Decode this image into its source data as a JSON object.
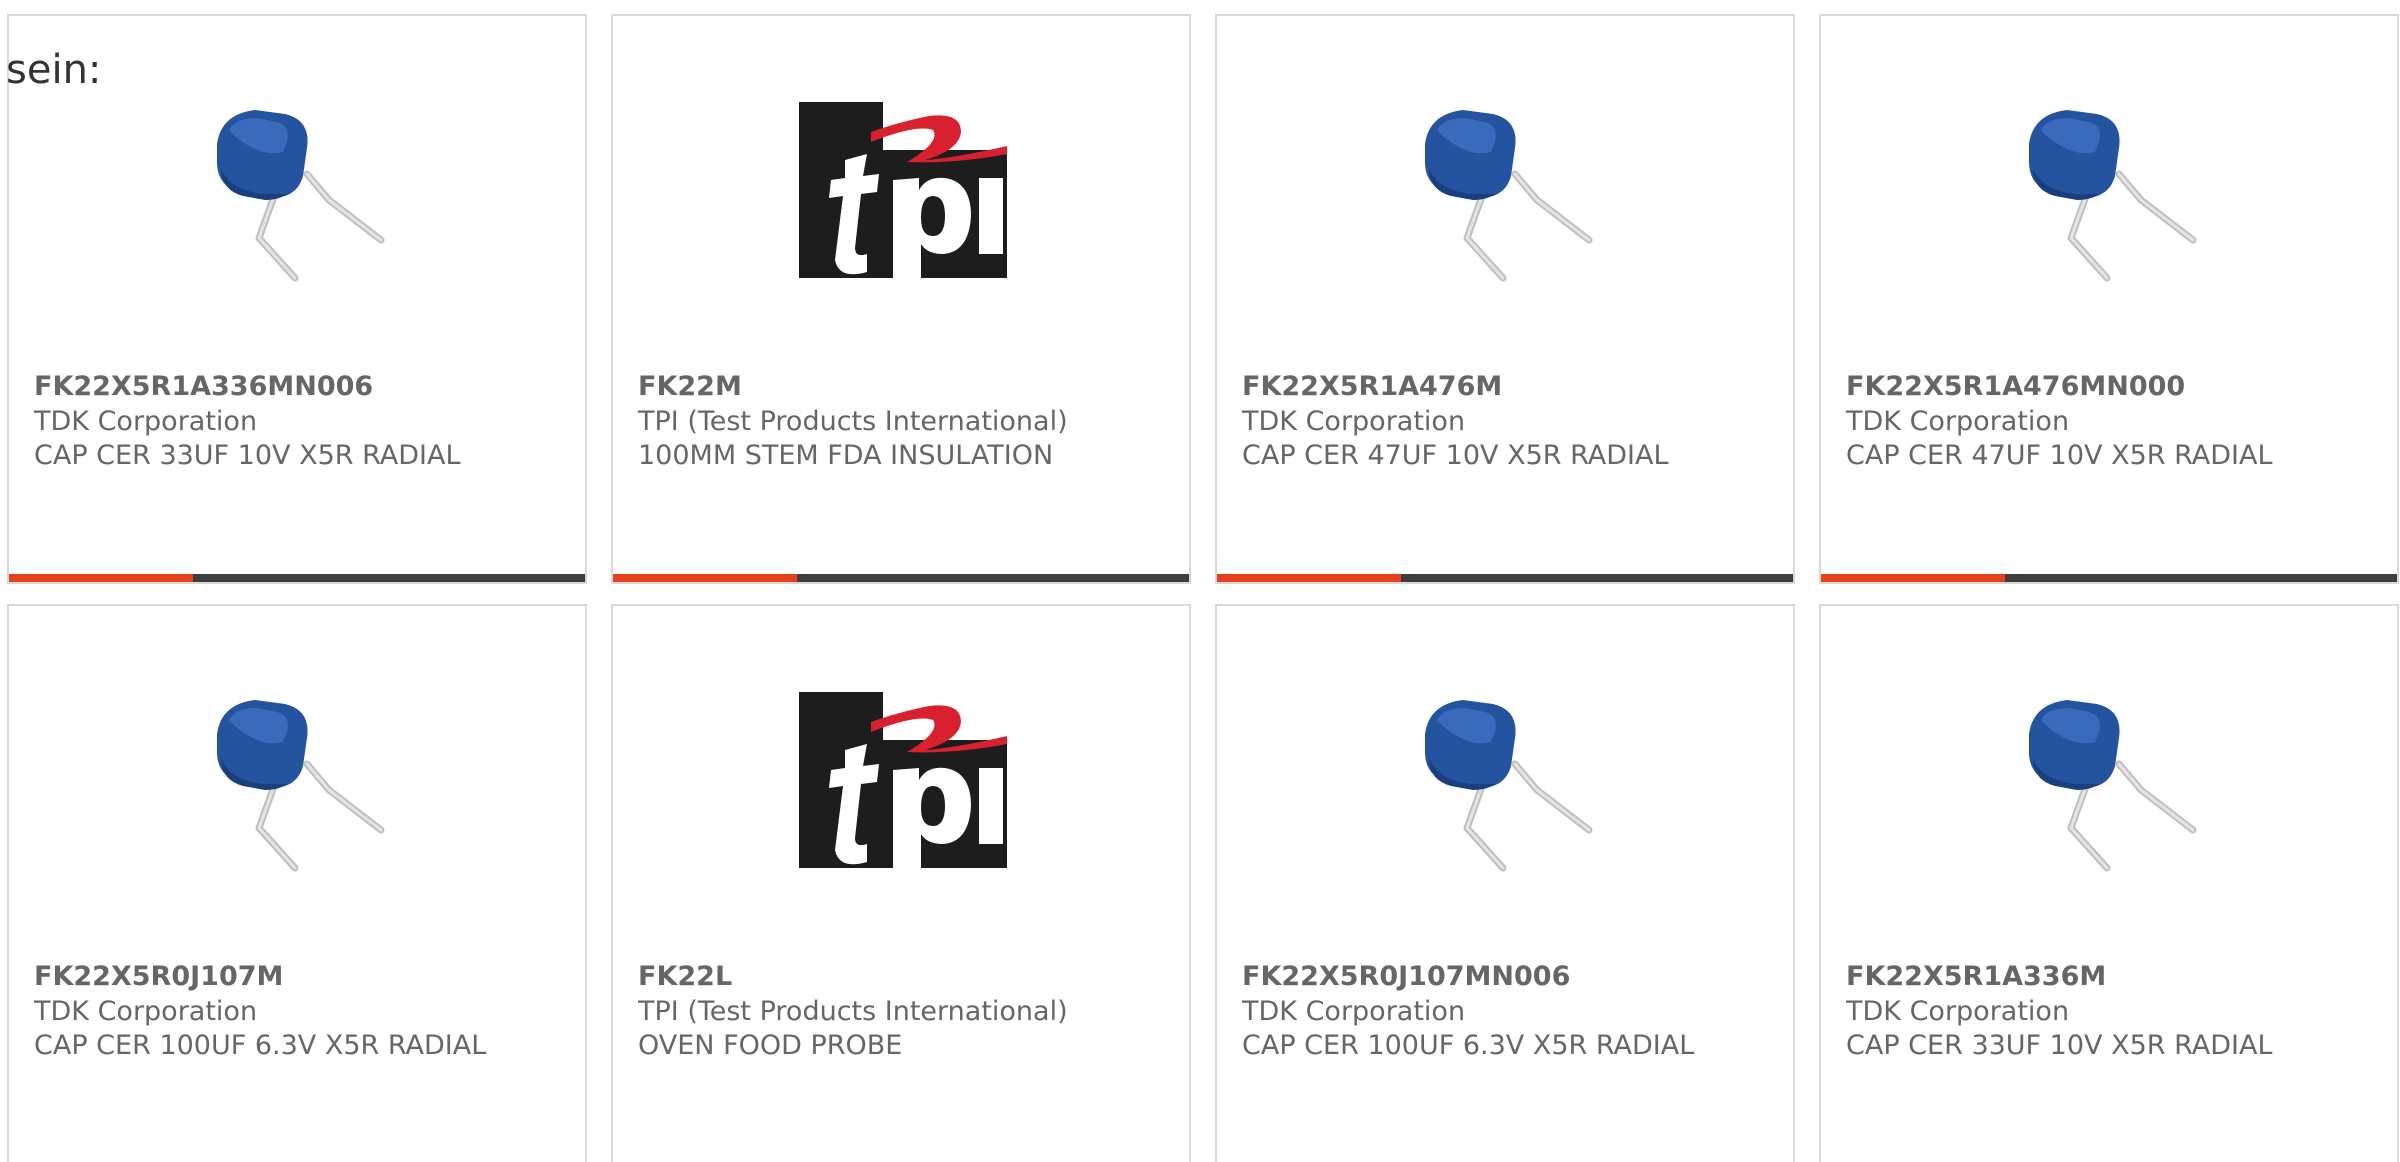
{
  "intro_text": "sein:",
  "accent_color": "#e8401c",
  "bar_color": "#3d3d3d",
  "text_color": "#666666",
  "products": [
    {
      "part": "FK22X5R1A336MN006",
      "manufacturer": "TDK Corporation",
      "description": "CAP CER 33UF 10V X5R RADIAL",
      "image": "capacitor-icon",
      "progress": 0.32
    },
    {
      "part": "FK22M",
      "manufacturer": "TPI (Test Products International)",
      "description": "100MM STEM FDA INSULATION",
      "image": "tpi-logo-icon",
      "progress": 0.32
    },
    {
      "part": "FK22X5R1A476M",
      "manufacturer": "TDK Corporation",
      "description": "CAP CER 47UF 10V X5R RADIAL",
      "image": "capacitor-icon",
      "progress": 0.32
    },
    {
      "part": "FK22X5R1A476MN000",
      "manufacturer": "TDK Corporation",
      "description": "CAP CER 47UF 10V X5R RADIAL",
      "image": "capacitor-icon",
      "progress": 0.32
    },
    {
      "part": "FK22X5R0J107M",
      "manufacturer": "TDK Corporation",
      "description": "CAP CER 100UF 6.3V X5R RADIAL",
      "image": "capacitor-icon",
      "progress": null
    },
    {
      "part": "FK22L",
      "manufacturer": "TPI (Test Products International)",
      "description": "OVEN FOOD PROBE",
      "image": "tpi-logo-icon",
      "progress": null
    },
    {
      "part": "FK22X5R0J107MN006",
      "manufacturer": "TDK Corporation",
      "description": "CAP CER 100UF 6.3V X5R RADIAL",
      "image": "capacitor-icon",
      "progress": null
    },
    {
      "part": "FK22X5R1A336M",
      "manufacturer": "TDK Corporation",
      "description": "CAP CER 33UF 10V X5R RADIAL",
      "image": "capacitor-icon",
      "progress": null
    }
  ]
}
